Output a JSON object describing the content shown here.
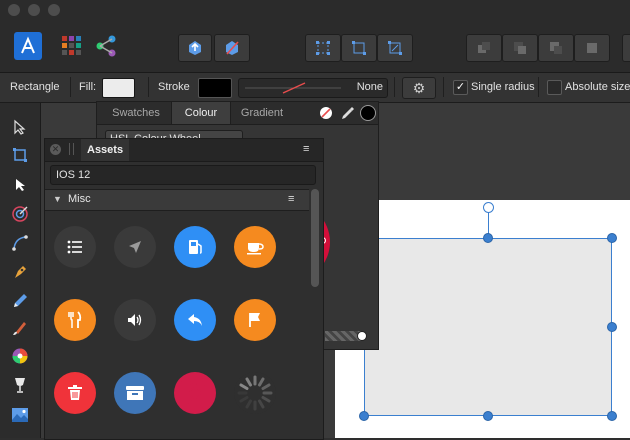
{
  "window": {
    "title": ""
  },
  "context_toolbar": {
    "tool_name": "Rectangle",
    "fill_label": "Fill:",
    "fill_color": "#ececec",
    "stroke_label": "Stroke",
    "stroke_color": "#000000",
    "stroke_style_value": "None",
    "single_radius_label": "Single radius",
    "single_radius_checked": true,
    "absolute_sizes_label": "Absolute sizes",
    "absolute_sizes_checked": false
  },
  "colour_panel": {
    "tabs": [
      "Swatches",
      "Colour",
      "Gradient"
    ],
    "active_tab": "Colour",
    "mode_select": "HSL Colour Wheel"
  },
  "assets_panel": {
    "title": "Assets",
    "library_select": "IOS 12",
    "category": "Misc",
    "icons": [
      {
        "name": "list-icon",
        "color": "#3a3a3a"
      },
      {
        "name": "location-arrow-icon",
        "color": "#3a3a3a"
      },
      {
        "name": "fuel-icon",
        "color": "#2f8ff5"
      },
      {
        "name": "coffee-cup-icon",
        "color": "#f58a1f"
      },
      {
        "name": "fork-knife-icon",
        "color": "#f58a1f"
      },
      {
        "name": "volume-icon",
        "color": "#3a3a3a"
      },
      {
        "name": "reply-icon",
        "color": "#2f8ff5"
      },
      {
        "name": "flag-icon",
        "color": "#f58a1f"
      },
      {
        "name": "trash-icon",
        "color": "#f0333a"
      },
      {
        "name": "archive-icon",
        "color": "#3f76b8"
      },
      {
        "name": "fingerprint-icon",
        "color": "#d21c4a"
      },
      {
        "name": "spinner-icon",
        "color": "#2f2f2f"
      }
    ]
  },
  "colors": {
    "accent": "#3b7fcf",
    "artboard": "#ffffff",
    "shape_fill": "#e8e8e8"
  }
}
